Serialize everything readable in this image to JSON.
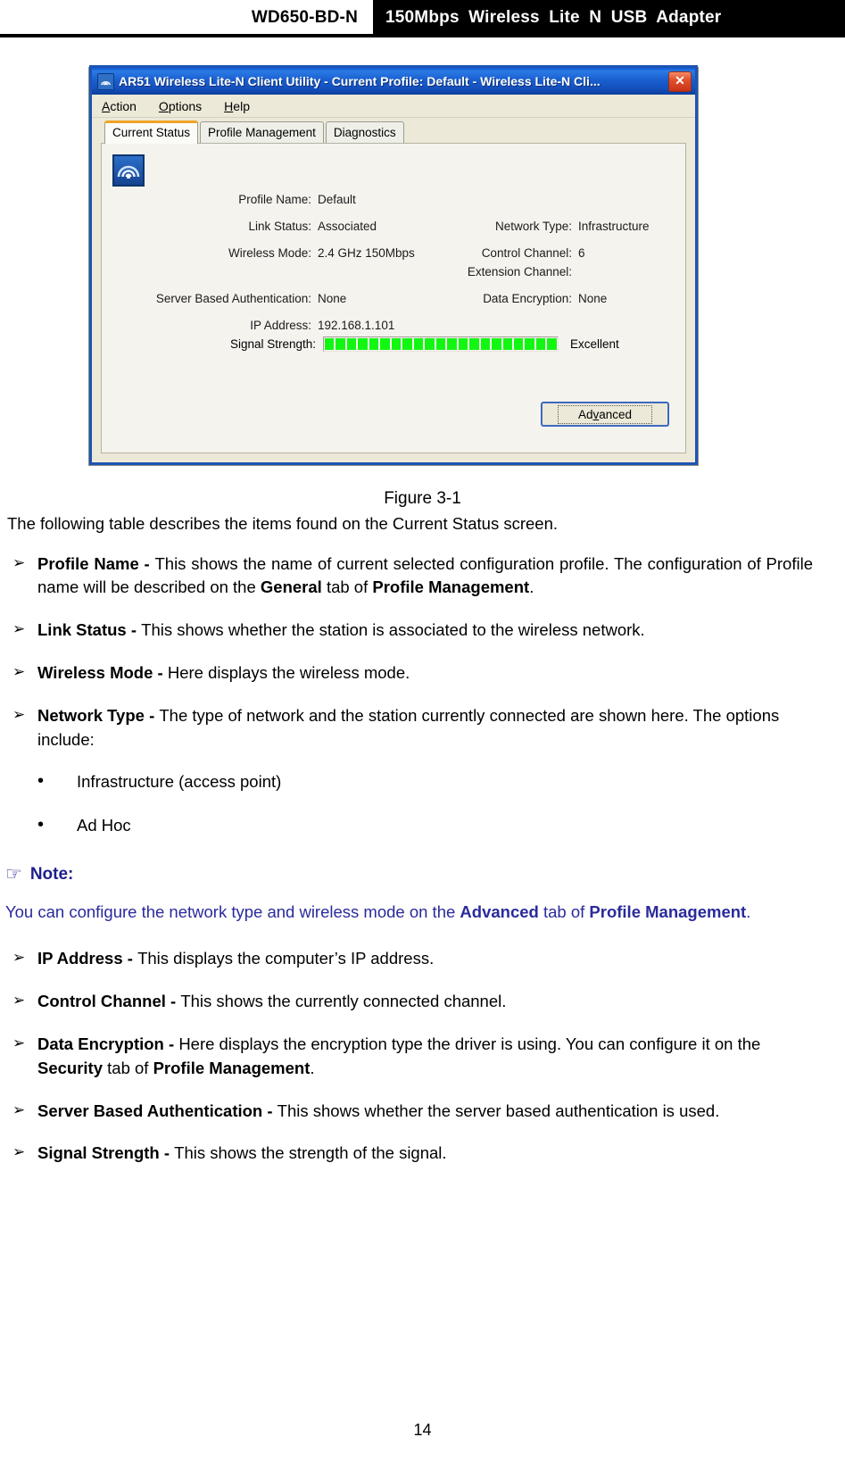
{
  "page_header": {
    "model": "WD650-BD-N",
    "product_name": "150Mbps  Wireless  Lite  N  USB  Adapter"
  },
  "screenshot": {
    "window_title": "AR51 Wireless Lite-N Client Utility - Current Profile: Default - Wireless Lite-N Cli...",
    "close_label": "✕",
    "menus": [
      {
        "accel": "A",
        "rest": "ction"
      },
      {
        "accel": "O",
        "rest": "ptions"
      },
      {
        "accel": "H",
        "rest": "elp"
      }
    ],
    "tabs": [
      {
        "label": "Current Status",
        "active": true
      },
      {
        "label": "Profile Management",
        "active": false
      },
      {
        "label": "Diagnostics",
        "active": false
      }
    ],
    "fields": {
      "profile_name_label": "Profile Name:",
      "profile_name_value": "Default",
      "link_status_label": "Link Status:",
      "link_status_value": "Associated",
      "network_type_label": "Network Type:",
      "network_type_value": "Infrastructure",
      "wireless_mode_label": "Wireless Mode:",
      "wireless_mode_value": "2.4 GHz 150Mbps",
      "control_channel_label": "Control Channel:",
      "control_channel_value": "6",
      "extension_channel_label": "Extension Channel:",
      "extension_channel_value": "",
      "server_based_auth_label": "Server Based Authentication:",
      "server_based_auth_value": "None",
      "data_encryption_label": "Data Encryption:",
      "data_encryption_value": "None",
      "ip_address_label": "IP Address:",
      "ip_address_value": "192.168.1.101",
      "signal_strength_label": "Signal Strength:",
      "signal_strength_quality": "Excellent",
      "signal_strength_segments": 21,
      "signal_color": "#12f712"
    },
    "advanced_button": {
      "accel_before": "Ad",
      "accel": "v",
      "accel_after": "anced"
    }
  },
  "document": {
    "figure_caption": "Figure 3-1",
    "intro": "The following table describes the items found on the Current Status screen.",
    "bullet_marker": "➢",
    "sub_marker": "•",
    "bullets": [
      {
        "term": "Profile Name - ",
        "text_1": "This shows the name of current selected configuration profile. The configuration of Profile name will be described on the ",
        "bold_1": "General",
        "text_2": " tab of ",
        "bold_2": "Profile Management",
        "text_3": "."
      },
      {
        "term": "Link Status - ",
        "text_1": "This shows whether the station is associated to the wireless network.",
        "bold_1": "",
        "text_2": "",
        "bold_2": "",
        "text_3": ""
      },
      {
        "term": "Wireless Mode - ",
        "text_1": "Here displays the wireless mode.",
        "bold_1": "",
        "text_2": "",
        "bold_2": "",
        "text_3": ""
      },
      {
        "term": "Network Type - ",
        "text_1": "The type of network and the station currently connected are shown here. The options include:",
        "bold_1": "",
        "text_2": "",
        "bold_2": "",
        "text_3": ""
      }
    ],
    "sub_items": [
      "Infrastructure (access point)",
      "Ad Hoc"
    ],
    "note": {
      "hand_icon": "☞",
      "title": "Note:",
      "text_1": "You can configure the network type and wireless mode on the ",
      "bold_1": "Advanced",
      "text_2": " tab of ",
      "bold_2": "Profile Management",
      "text_3": ".",
      "color": "#2a2a9c"
    },
    "bullets_after_note": [
      {
        "term": "IP Address - ",
        "text_1": "This displays the computer’s IP address.",
        "bold_1": "",
        "text_2": "",
        "bold_2": "",
        "text_3": ""
      },
      {
        "term": "Control Channel - ",
        "text_1": "This shows the currently connected channel.",
        "bold_1": "",
        "text_2": "",
        "bold_2": "",
        "text_3": ""
      },
      {
        "term": "Data Encryption - ",
        "text_1": "Here displays the encryption type the driver is using. You can configure it on the ",
        "bold_1": "Security",
        "text_2": " tab of ",
        "bold_2": "Profile Management",
        "text_3": "."
      },
      {
        "term": "Server Based Authentication - ",
        "text_1": "This shows whether the server based authentication is used.",
        "bold_1": "",
        "text_2": "",
        "bold_2": "",
        "text_3": ""
      },
      {
        "term": "Signal Strength - ",
        "text_1": "This shows the strength of the signal.",
        "bold_1": "",
        "text_2": "",
        "bold_2": "",
        "text_3": ""
      }
    ],
    "page_number": "14"
  }
}
